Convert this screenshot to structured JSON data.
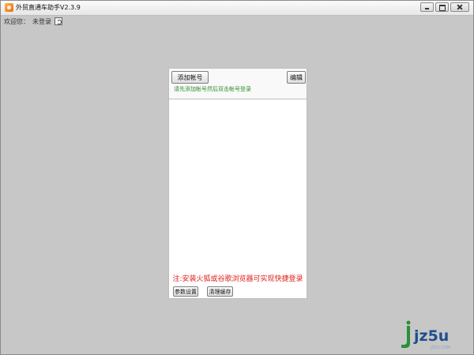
{
  "window": {
    "title": "外贸直通车助手V2.3.9",
    "controls": {
      "minimize_icon": "minimize-icon",
      "maximize_icon": "maximize-icon",
      "close_icon": "close-icon"
    }
  },
  "status_bar": {
    "welcome_label": "欢迎您：",
    "login_status": "未登录",
    "refresh_icon": "refresh-icon"
  },
  "panel": {
    "add_account_label": "添加帐号",
    "edit_label": "编辑",
    "hint": "请先添加帐号然后双击帐号登录",
    "accounts": [],
    "note": "注:安装火狐或谷歌浏览器可实现快捷登录",
    "settings_label": "参数设置",
    "clear_cache_label": "清理缓存"
  },
  "watermark": {
    "brand": "jz5u",
    "url": "JZ5U.COM"
  },
  "colors": {
    "background": "#c7c7c7",
    "hint_green": "#2f8f2f",
    "note_red": "#e0201b",
    "watermark_green": "#2b8f3a",
    "watermark_blue": "#1f4e8c"
  }
}
